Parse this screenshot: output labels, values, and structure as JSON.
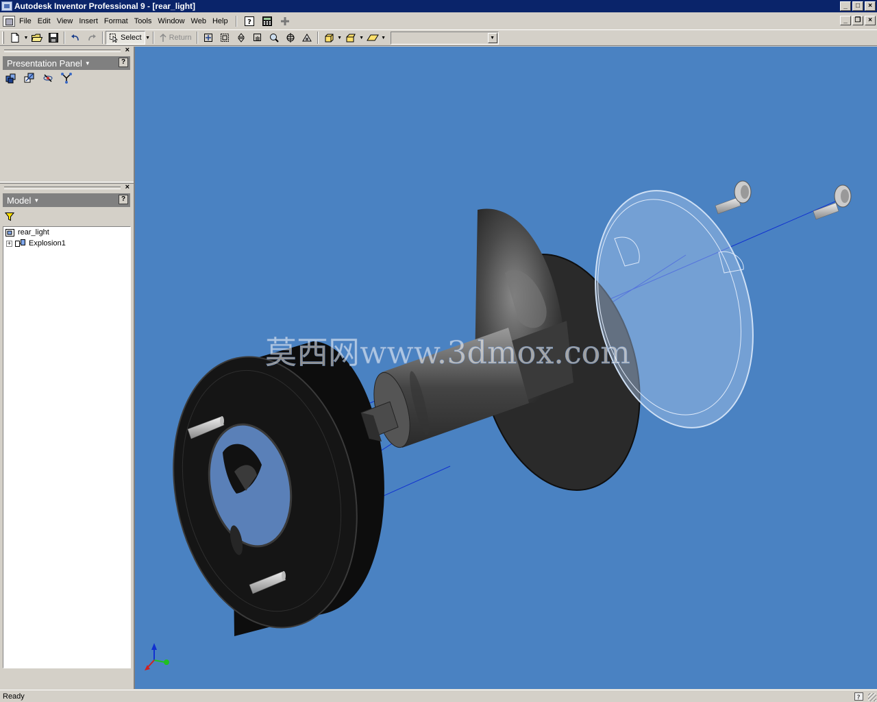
{
  "window": {
    "title": "Autodesk Inventor Professional 9 - [rear_light]"
  },
  "menu": {
    "items": [
      "File",
      "Edit",
      "View",
      "Insert",
      "Format",
      "Tools",
      "Window",
      "Web",
      "Help"
    ]
  },
  "toolbar": {
    "select_label": "Select",
    "return_label": "Return",
    "combo_value": ""
  },
  "presentation_panel": {
    "title": "Presentation Panel",
    "help": "?"
  },
  "model_panel": {
    "title": "Model",
    "help": "?",
    "tree": [
      {
        "label": "rear_light"
      },
      {
        "label": "Explosion1"
      }
    ]
  },
  "viewport": {
    "background": "#4a82c2",
    "watermark": "莫西网www.3dmox.com"
  },
  "statusbar": {
    "text": "Ready"
  }
}
